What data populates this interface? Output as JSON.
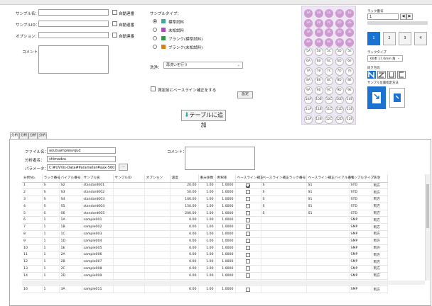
{
  "form": {
    "sample_name_label": "サンプル名：",
    "sample_id_label": "サンプルID：",
    "option_label": "オプション：",
    "comment_label": "コメント：",
    "auto_increment": "自動連番"
  },
  "sample_type": {
    "label": "サンプルタイプ：",
    "options": [
      {
        "label": "標準試料",
        "color": "#3ea89a",
        "selected": true
      },
      {
        "label": "未知試料",
        "color": "#b344c6",
        "selected": false
      },
      {
        "label": "ブランク(標準試料)",
        "color": "#2d9c3a",
        "selected": false
      },
      {
        "label": "ブランク(未知試料)",
        "color": "#e07d12",
        "selected": false
      }
    ]
  },
  "wash": {
    "label": "洗浄：",
    "value": "再洗いを行う"
  },
  "baseline_check": "測定前にベースライン補正をする",
  "settings_button": "設定",
  "add_table_button": "テーブルに追加",
  "rack": {
    "rows": [
      [
        "1A",
        "1B",
        "1C",
        "1D",
        "1E"
      ],
      [
        "2A",
        "2B",
        "2C",
        "2D",
        "2E"
      ],
      [
        "3A",
        "3B",
        "3C",
        "3D",
        "3E"
      ],
      [
        "4A",
        "4B",
        "4C",
        "4D",
        "4E"
      ],
      [
        "5A",
        "5B",
        "5C",
        "5D",
        "5E"
      ],
      [
        "6A",
        "6B",
        "6C",
        "6D",
        "6E"
      ],
      [
        "7A",
        "7B",
        "7C",
        "7D",
        "7E"
      ],
      [
        "8A",
        "8B",
        "8C",
        "8D",
        "8E"
      ],
      [
        "9A",
        "9B",
        "9C",
        "9D",
        "9E"
      ],
      [
        "10A",
        "10B",
        "10C",
        "10D",
        "10E"
      ],
      [
        "11A",
        "11B",
        "11C",
        "11D",
        "11E"
      ],
      [
        "12A",
        "12B",
        "12C",
        "12D",
        "12E"
      ]
    ],
    "selected_rows": 4
  },
  "rack_no": {
    "label": "ラック番号",
    "value": "1"
  },
  "rack_buttons": [
    "1",
    "2",
    "3",
    "4"
  ],
  "rack_type": {
    "label": "ラックタイプ",
    "value": "60本 17.0mm 角"
  },
  "direction_label": "向き方向",
  "sample_order_label": "サンプル位置指定方法",
  "tabs": [
    "分析1",
    "分析2",
    "分析3",
    "分析4"
  ],
  "file": {
    "file_label": "ファイル名：",
    "file_value": "aoutsamplesvqud",
    "analyst_label": "分析者名：",
    "analyst_value": "shimadzu",
    "param_label": "パラメータ：",
    "param_value": "C:#UVVis-Data#Parameter#aax-560.vi",
    "browse": "...",
    "comment_label": "コメント："
  },
  "table": {
    "headers": [
      "分析No.",
      "ラック番号",
      "バイアル番号",
      "サンプル名",
      "サンプルID",
      "オプション",
      "濃度",
      "重み係数",
      "希釈率",
      "ベースライン補正",
      "ベースライン補正ラック番号",
      "ベースライン補正バイアル番号",
      "サンプルタイプ",
      "洗浄"
    ],
    "rows": [
      [
        "1",
        "S",
        "S2",
        "standard001",
        "",
        "",
        "20.00",
        "1.00",
        "1.0000",
        true,
        "S",
        "S1",
        "STD",
        "両方"
      ],
      [
        "2",
        "S",
        "S3",
        "standard002",
        "",
        "",
        "50.00",
        "1.00",
        "1.0000",
        false,
        "S",
        "S1",
        "STD",
        "両方"
      ],
      [
        "3",
        "S",
        "S4",
        "standard003",
        "",
        "",
        "100.00",
        "1.00",
        "1.0000",
        false,
        "S",
        "S1",
        "STD",
        "両方"
      ],
      [
        "4",
        "S",
        "S5",
        "standard004",
        "",
        "",
        "150.00",
        "1.00",
        "1.0000",
        false,
        "S",
        "S1",
        "STD",
        "両方"
      ],
      [
        "5",
        "S",
        "S6",
        "standard005",
        "",
        "",
        "200.00",
        "1.00",
        "1.0000",
        false,
        "S",
        "S1",
        "STD",
        "両方"
      ],
      [
        "6",
        "1",
        "1A",
        "sample001",
        "",
        "",
        "0.00",
        "1.00",
        "1.0000",
        false,
        "",
        "",
        "SMP",
        "両方"
      ],
      [
        "7",
        "1",
        "1B",
        "sample002",
        "",
        "",
        "0.00",
        "1.00",
        "1.0000",
        false,
        "",
        "",
        "SMP",
        "両方"
      ],
      [
        "8",
        "1",
        "1C",
        "sample003",
        "",
        "",
        "0.00",
        "1.00",
        "1.0000",
        false,
        "",
        "",
        "SMP",
        "両方"
      ],
      [
        "9",
        "1",
        "1D",
        "sample004",
        "",
        "",
        "0.00",
        "1.00",
        "1.0000",
        false,
        "",
        "",
        "SMP",
        "両方"
      ],
      [
        "10",
        "1",
        "1E",
        "sample005",
        "",
        "",
        "0.00",
        "1.00",
        "1.0000",
        false,
        "",
        "",
        "SMP",
        "両方"
      ],
      [
        "11",
        "1",
        "2A",
        "sample006",
        "",
        "",
        "0.00",
        "1.00",
        "1.0000",
        false,
        "",
        "",
        "SMP",
        "両方"
      ],
      [
        "12",
        "1",
        "2B",
        "sample007",
        "",
        "",
        "0.00",
        "1.00",
        "1.0000",
        false,
        "",
        "",
        "SMP",
        "両方"
      ],
      [
        "13",
        "1",
        "2C",
        "sample008",
        "",
        "",
        "0.00",
        "1.00",
        "1.0000",
        false,
        "",
        "",
        "SMP",
        "両方"
      ],
      [
        "14",
        "1",
        "2D",
        "sample009",
        "",
        "",
        "0.00",
        "1.00",
        "1.0000",
        false,
        "",
        "",
        "SMP",
        "両方"
      ],
      [
        "15",
        "1",
        "2E",
        "sample010",
        "",
        "",
        "0.00",
        "1.00",
        "1.0000",
        false,
        "",
        "",
        "SMP",
        "両方"
      ],
      [
        "16",
        "1",
        "3A",
        "sample011",
        "",
        "",
        "0.00",
        "1.00",
        "1.0000",
        false,
        "",
        "",
        "SMP",
        "両方"
      ]
    ]
  }
}
